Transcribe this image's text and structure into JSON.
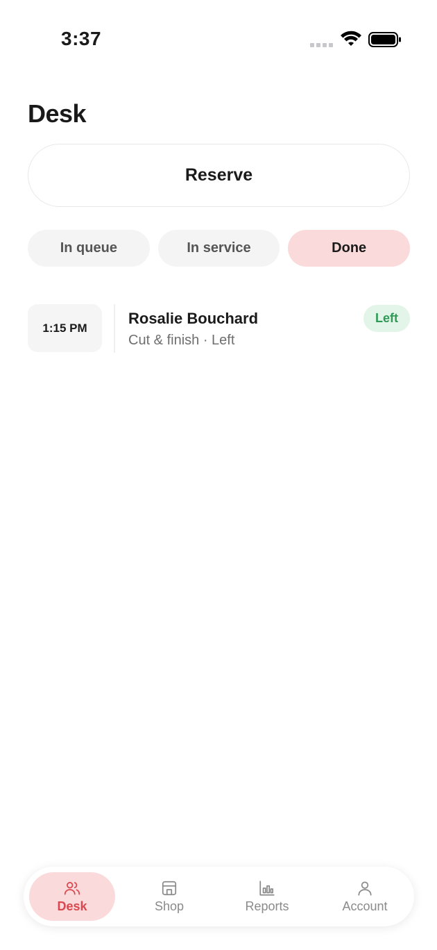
{
  "status_bar": {
    "time": "3:37"
  },
  "header": {
    "title": "Desk"
  },
  "reserve_button": {
    "label": "Reserve"
  },
  "tabs": [
    {
      "label": "In queue",
      "active": false
    },
    {
      "label": "In service",
      "active": false
    },
    {
      "label": "Done",
      "active": true
    }
  ],
  "appointments": [
    {
      "time": "1:15 PM",
      "name": "Rosalie Bouchard",
      "detail": "Cut & finish · Left",
      "status": "Left"
    }
  ],
  "bottom_nav": [
    {
      "label": "Desk",
      "icon": "users-icon",
      "active": true
    },
    {
      "label": "Shop",
      "icon": "store-icon",
      "active": false
    },
    {
      "label": "Reports",
      "icon": "bar-chart-icon",
      "active": false
    },
    {
      "label": "Account",
      "icon": "user-icon",
      "active": false
    }
  ],
  "colors": {
    "accent": "#d9474f",
    "accent_bg": "#fadada",
    "success": "#2e9a55",
    "success_bg": "#e3f4e8"
  }
}
